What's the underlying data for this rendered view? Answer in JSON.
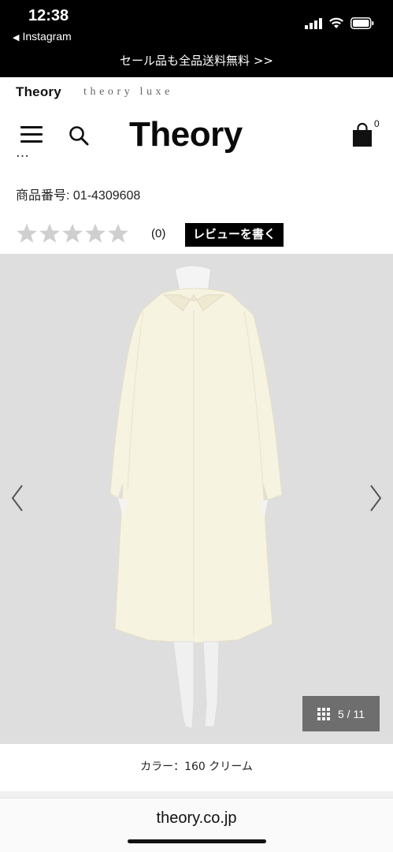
{
  "status_bar": {
    "time": "12:38",
    "back_app": "Instagram"
  },
  "banner": {
    "text": "セール品も全品送料無料 >>"
  },
  "brand_tabs": {
    "theory": "Theory",
    "theory_luxe": "theory luxe"
  },
  "header": {
    "logo": "Theory",
    "cart_count": "0"
  },
  "product": {
    "title_partial": "…",
    "product_number": "商品番号: 01-4309608",
    "rating": {
      "stars_filled": 0,
      "stars_total": 5,
      "review_count": "(0)",
      "write_review_label": "レビューを書く"
    },
    "gallery": {
      "counter": "5 / 11"
    },
    "color": "カラー：160 クリーム"
  },
  "browser": {
    "url": "theory.co.jp"
  },
  "colors": {
    "banner_bg": "#000000",
    "gallery_bg": "#dedede",
    "counter_bg": "#6e6e6e",
    "star_empty": "#cfcfcf",
    "coat": "#f6f2df"
  }
}
